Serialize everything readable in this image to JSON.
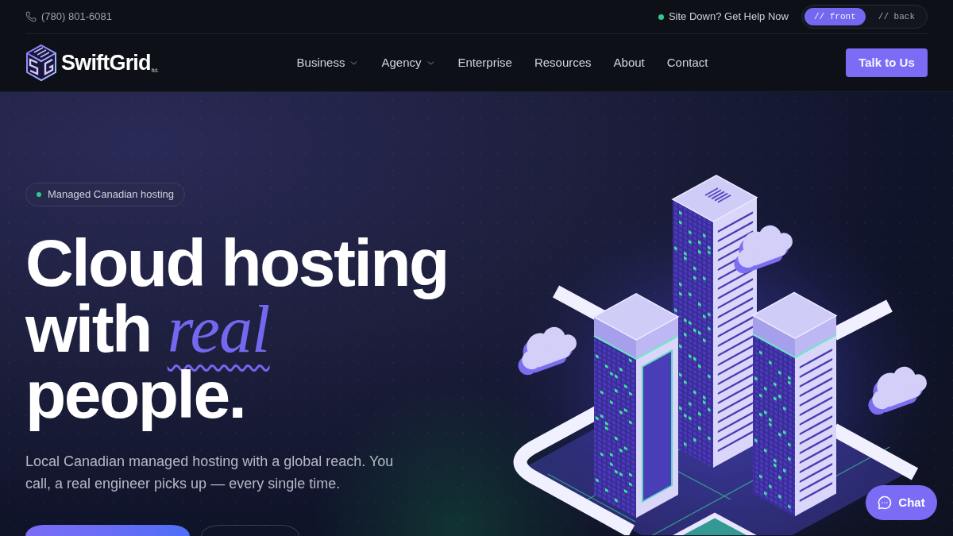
{
  "top_bar": {
    "phone": "(780) 801-6081",
    "status_link": "Site Down? Get Help Now",
    "view_toggle": [
      {
        "label": "// front",
        "selected": true
      },
      {
        "label": "// back",
        "selected": false
      }
    ]
  },
  "header": {
    "logo": {
      "name": "SwiftGrid",
      "suffix": "ltd."
    },
    "nav": [
      {
        "label": "Business",
        "kind": "dropdown"
      },
      {
        "label": "Agency",
        "kind": "dropdown"
      },
      {
        "label": "Enterprise",
        "kind": "link"
      },
      {
        "label": "Resources",
        "kind": "link"
      },
      {
        "label": "About",
        "kind": "link"
      },
      {
        "label": "Contact",
        "kind": "link"
      }
    ],
    "cta": "Talk to Us"
  },
  "hero": {
    "badge": "Managed Canadian hosting",
    "heading": "Cloud hosting with *real* people.",
    "subtitle": "Local Canadian managed hosting with a global reach. You call, a real engineer picks up — every single time.",
    "buttons": [
      {
        "kind": "primary"
      },
      {
        "kind": "secondary"
      }
    ]
  },
  "chat_button": {
    "label": "Chat"
  }
}
